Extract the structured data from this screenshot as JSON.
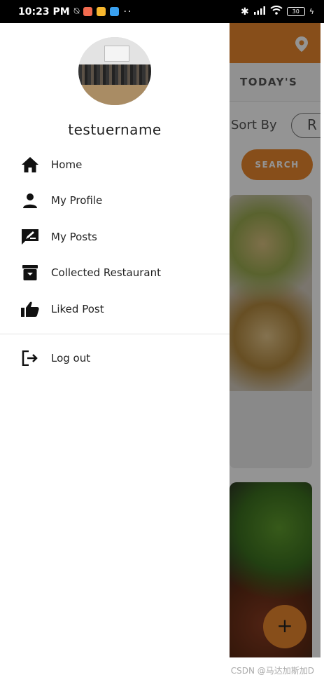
{
  "status_bar": {
    "time": "10:23 PM",
    "left_icons": [
      "mute-icon",
      "app-notif-red",
      "app-notif-yellow",
      "app-notif-blue"
    ],
    "more": "··",
    "battery": "30",
    "right_icons": [
      "bluetooth-icon",
      "signal-icon",
      "wifi-icon",
      "battery-icon",
      "charging-icon"
    ]
  },
  "drawer": {
    "username": "testuername",
    "menu": [
      {
        "label": "Home",
        "icon": "home-icon"
      },
      {
        "label": "My Profile",
        "icon": "person-icon"
      },
      {
        "label": "My Posts",
        "icon": "edit-post-icon"
      },
      {
        "label": "Collected Restaurant",
        "icon": "archive-icon"
      },
      {
        "label": "Liked Post",
        "icon": "thumb-up-icon"
      }
    ],
    "logout": {
      "label": "Log out",
      "icon": "logout-icon"
    }
  },
  "background_app": {
    "tab_label": "TODAY'S",
    "sort_label": "Sort By",
    "sort_value": "R",
    "search_button": "SEARCH",
    "fab_label": "+",
    "accent_color": "#e9872e"
  },
  "watermark": "CSDN @马达加斯加D"
}
